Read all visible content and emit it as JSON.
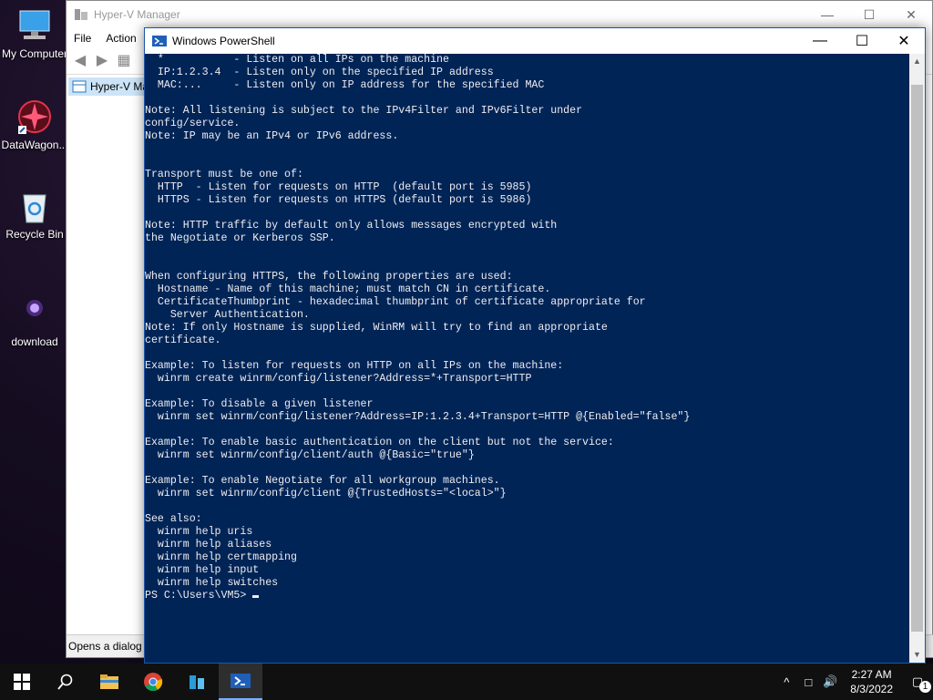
{
  "desktop": {
    "icons": [
      {
        "label": "My Computer"
      },
      {
        "label": "DataWagon..."
      },
      {
        "label": "Recycle Bin"
      },
      {
        "label": "download"
      }
    ]
  },
  "hyperv": {
    "title": "Hyper-V Manager",
    "menu": [
      "File",
      "Action"
    ],
    "tree_node": "Hyper-V Ma",
    "status": "Opens a dialog f"
  },
  "powershell": {
    "title": "Windows PowerShell",
    "lines": [
      "  *           - Listen on all IPs on the machine",
      "  IP:1.2.3.4  - Listen only on the specified IP address",
      "  MAC:...     - Listen only on IP address for the specified MAC",
      "",
      "Note: All listening is subject to the IPv4Filter and IPv6Filter under",
      "config/service.",
      "Note: IP may be an IPv4 or IPv6 address.",
      "",
      "",
      "Transport must be one of:",
      "  HTTP  - Listen for requests on HTTP  (default port is 5985)",
      "  HTTPS - Listen for requests on HTTPS (default port is 5986)",
      "",
      "Note: HTTP traffic by default only allows messages encrypted with",
      "the Negotiate or Kerberos SSP.",
      "",
      "",
      "When configuring HTTPS, the following properties are used:",
      "  Hostname - Name of this machine; must match CN in certificate.",
      "  CertificateThumbprint - hexadecimal thumbprint of certificate appropriate for",
      "    Server Authentication.",
      "Note: If only Hostname is supplied, WinRM will try to find an appropriate",
      "certificate.",
      "",
      "Example: To listen for requests on HTTP on all IPs on the machine:",
      "  winrm create winrm/config/listener?Address=*+Transport=HTTP",
      "",
      "Example: To disable a given listener",
      "  winrm set winrm/config/listener?Address=IP:1.2.3.4+Transport=HTTP @{Enabled=\"false\"}",
      "",
      "Example: To enable basic authentication on the client but not the service:",
      "  winrm set winrm/config/client/auth @{Basic=\"true\"}",
      "",
      "Example: To enable Negotiate for all workgroup machines.",
      "  winrm set winrm/config/client @{TrustedHosts=\"<local>\"}",
      "",
      "See also:",
      "  winrm help uris",
      "  winrm help aliases",
      "  winrm help certmapping",
      "  winrm help input",
      "  winrm help switches"
    ],
    "prompt": "PS C:\\Users\\VM5> "
  },
  "taskbar": {
    "time": "2:27 AM",
    "date": "8/3/2022",
    "notifications": "1"
  }
}
